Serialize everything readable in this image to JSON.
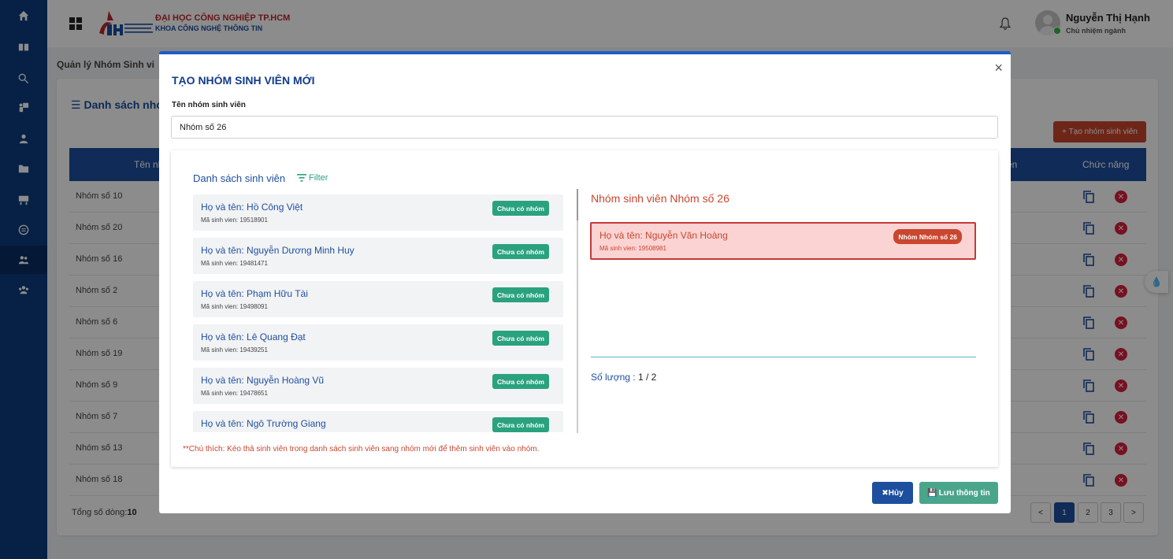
{
  "header": {
    "university": "ĐẠI HỌC CÔNG NGHIỆP TP.HCM",
    "department": "KHOA CÔNG NGHỆ THÔNG TIN",
    "user_name": "Nguyễn Thị Hạnh",
    "user_role": "Chủ nhiệm ngành"
  },
  "sidebar": {
    "items": [
      {
        "icon": "home-icon"
      },
      {
        "icon": "book-icon"
      },
      {
        "icon": "search-icon"
      },
      {
        "icon": "teacher-icon"
      },
      {
        "icon": "student-icon"
      },
      {
        "icon": "folder-icon"
      },
      {
        "icon": "board-icon"
      },
      {
        "icon": "chat-icon"
      },
      {
        "icon": "group-icon",
        "active": true
      },
      {
        "icon": "users-icon"
      }
    ]
  },
  "page": {
    "breadcrumb": "Quản lý Nhóm Sinh vi",
    "card_title": "Danh sách nhó",
    "create_button": "Tạo nhóm sinh viên",
    "table_headers": [
      "Tên nh",
      "ên",
      "Chức năng"
    ],
    "rows": [
      "Nhóm số 10",
      "Nhóm số 20",
      "Nhóm số 16",
      "Nhóm số 2",
      "Nhóm số 6",
      "Nhóm số 19",
      "Nhóm số 9",
      "Nhóm số 7",
      "Nhóm số 13",
      "Nhóm số 18"
    ],
    "total_label": "Tổng số dòng:",
    "total_value": "10",
    "pages": [
      "<",
      "1",
      "2",
      "3",
      ">"
    ]
  },
  "modal": {
    "title": "TẠO NHÓM SINH VIÊN MỚI",
    "close": "×",
    "name_label": "Tên nhóm sinh viên",
    "name_value": "Nhóm số 26",
    "list_title": "Danh sách sinh viên",
    "filter_label": "Filter",
    "students": [
      {
        "name": "Họ và tên: Hồ Công Việt",
        "id": "Mã sinh vien: 19518901",
        "status": "Chưa có nhóm"
      },
      {
        "name": "Họ và tên: Nguyễn Dương Minh Huy",
        "id": "Mã sinh vien: 19481471",
        "status": "Chưa có nhóm"
      },
      {
        "name": "Họ và tên: Phạm Hữu Tài",
        "id": "Mã sinh vien: 19498091",
        "status": "Chưa có nhóm"
      },
      {
        "name": "Họ và tên: Lê Quang Đạt",
        "id": "Mã sinh vien: 19439251",
        "status": "Chưa có nhóm"
      },
      {
        "name": "Họ và tên: Nguyễn Hoàng Vũ",
        "id": "Mã sinh vien: 19478651",
        "status": "Chưa có nhóm"
      },
      {
        "name": "Họ và tên: Ngô Trường Giang",
        "id": "",
        "status": "Chưa có nhóm"
      }
    ],
    "group_title": "Nhóm sinh viên Nhóm số 26",
    "group_members": [
      {
        "name": "Họ và tên: Nguyễn Văn Hoàng",
        "id": "Mã sinh vien: 19508981",
        "badge": "Nhóm Nhóm số 26"
      }
    ],
    "count_label": "Số lượng :",
    "count_value": "1 / 2",
    "note": "**Chú thích: Kéo thả sinh viên trong danh sách sinh viên sang nhóm mới để thêm sinh viên vào nhóm.",
    "cancel_button": "Hủy",
    "save_button": "Lưu thông tin"
  },
  "colors": {
    "sidebar": "#0d3b80",
    "primary": "#1e4f9e",
    "accent_red": "#c9462f",
    "accent_green": "#2aa27d"
  }
}
